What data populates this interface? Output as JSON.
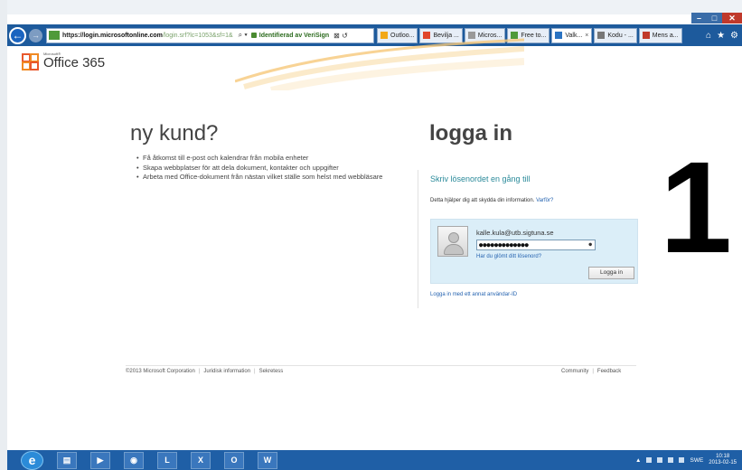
{
  "window": {
    "min_icon": "–",
    "max_icon": "□",
    "close_icon": "✕"
  },
  "browser": {
    "back_icon": "←",
    "forward_icon": "→",
    "url_scheme": "https://",
    "url_host": "login.microsoftonline.com",
    "url_path": "/login.srf?lc=1053&sf=1&",
    "search_glyph": "⌕ ▾",
    "verisign": "Identifierad av VeriSign",
    "addr_tools": "⊠ ↺",
    "tabs": [
      {
        "label": "Outloo...",
        "color": "#f2a818"
      },
      {
        "label": "Bevilja ...",
        "color": "#e0452b"
      },
      {
        "label": "Micros...",
        "color": "#999999"
      },
      {
        "label": "Free to...",
        "color": "#4f9a3a"
      },
      {
        "label": "Valk...",
        "color": "#2a73c2",
        "active": true
      },
      {
        "label": "Kodu - ...",
        "color": "#777777"
      },
      {
        "label": "Mens a...",
        "color": "#c0392b"
      }
    ],
    "tab_close": "×",
    "right_icons": [
      "⌂",
      "★",
      "⚙"
    ]
  },
  "brand": {
    "small": "Microsoft®",
    "name": "Office 365"
  },
  "new_customer": {
    "title": "ny kund?",
    "bullets": [
      "Få åtkomst till e-post och kalendrar från mobila enheter",
      "Skapa webbplatser för att dela dokument, kontakter och uppgifter",
      "Arbeta med Office-dokument från nästan vilket ställe som helst med webbläsare"
    ]
  },
  "login": {
    "title": "logga in",
    "prompt": "Skriv lösenordet en gång till",
    "help": "Detta hjälper dig att skydda din information.",
    "help_link": "Varför?",
    "username": "kalle.kula@utb.sigtuna.se",
    "password_mask": "●●●●●●●●●●●●●",
    "forgot": "Har du glömt ditt lösenord?",
    "signin": "Logga in",
    "other_id": "Logga in med ett annat användar-ID"
  },
  "annotation": "1",
  "footer": {
    "copyright": "©2013 Microsoft Corporation",
    "legal": "Juridisk information",
    "privacy": "Sekretess",
    "community": "Community",
    "feedback": "Feedback"
  },
  "taskbar": {
    "start_icon": "e",
    "apps": [
      {
        "name": "explorer-icon",
        "glyph": "▤"
      },
      {
        "name": "media-player-icon",
        "glyph": "▶"
      },
      {
        "name": "chrome-icon",
        "glyph": "◉"
      },
      {
        "name": "lync-icon",
        "glyph": "L"
      },
      {
        "name": "excel-icon",
        "glyph": "X"
      },
      {
        "name": "outlook-icon",
        "glyph": "O"
      },
      {
        "name": "word-icon",
        "glyph": "W"
      }
    ],
    "tray_arrow": "▲",
    "language": "SWE",
    "time": "10:18",
    "date": "2013-02-15"
  }
}
